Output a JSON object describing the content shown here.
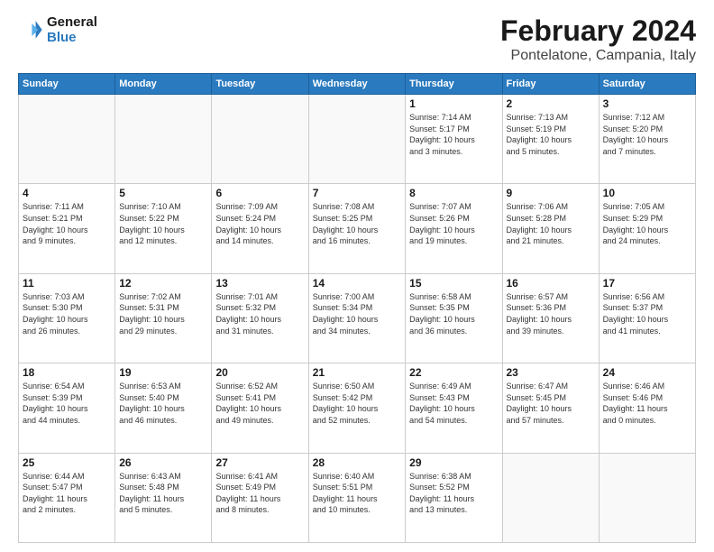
{
  "header": {
    "logo_line1": "General",
    "logo_line2": "Blue",
    "title": "February 2024",
    "subtitle": "Pontelatone, Campania, Italy"
  },
  "weekdays": [
    "Sunday",
    "Monday",
    "Tuesday",
    "Wednesday",
    "Thursday",
    "Friday",
    "Saturday"
  ],
  "weeks": [
    [
      {
        "day": "",
        "info": ""
      },
      {
        "day": "",
        "info": ""
      },
      {
        "day": "",
        "info": ""
      },
      {
        "day": "",
        "info": ""
      },
      {
        "day": "1",
        "info": "Sunrise: 7:14 AM\nSunset: 5:17 PM\nDaylight: 10 hours\nand 3 minutes."
      },
      {
        "day": "2",
        "info": "Sunrise: 7:13 AM\nSunset: 5:19 PM\nDaylight: 10 hours\nand 5 minutes."
      },
      {
        "day": "3",
        "info": "Sunrise: 7:12 AM\nSunset: 5:20 PM\nDaylight: 10 hours\nand 7 minutes."
      }
    ],
    [
      {
        "day": "4",
        "info": "Sunrise: 7:11 AM\nSunset: 5:21 PM\nDaylight: 10 hours\nand 9 minutes."
      },
      {
        "day": "5",
        "info": "Sunrise: 7:10 AM\nSunset: 5:22 PM\nDaylight: 10 hours\nand 12 minutes."
      },
      {
        "day": "6",
        "info": "Sunrise: 7:09 AM\nSunset: 5:24 PM\nDaylight: 10 hours\nand 14 minutes."
      },
      {
        "day": "7",
        "info": "Sunrise: 7:08 AM\nSunset: 5:25 PM\nDaylight: 10 hours\nand 16 minutes."
      },
      {
        "day": "8",
        "info": "Sunrise: 7:07 AM\nSunset: 5:26 PM\nDaylight: 10 hours\nand 19 minutes."
      },
      {
        "day": "9",
        "info": "Sunrise: 7:06 AM\nSunset: 5:28 PM\nDaylight: 10 hours\nand 21 minutes."
      },
      {
        "day": "10",
        "info": "Sunrise: 7:05 AM\nSunset: 5:29 PM\nDaylight: 10 hours\nand 24 minutes."
      }
    ],
    [
      {
        "day": "11",
        "info": "Sunrise: 7:03 AM\nSunset: 5:30 PM\nDaylight: 10 hours\nand 26 minutes."
      },
      {
        "day": "12",
        "info": "Sunrise: 7:02 AM\nSunset: 5:31 PM\nDaylight: 10 hours\nand 29 minutes."
      },
      {
        "day": "13",
        "info": "Sunrise: 7:01 AM\nSunset: 5:32 PM\nDaylight: 10 hours\nand 31 minutes."
      },
      {
        "day": "14",
        "info": "Sunrise: 7:00 AM\nSunset: 5:34 PM\nDaylight: 10 hours\nand 34 minutes."
      },
      {
        "day": "15",
        "info": "Sunrise: 6:58 AM\nSunset: 5:35 PM\nDaylight: 10 hours\nand 36 minutes."
      },
      {
        "day": "16",
        "info": "Sunrise: 6:57 AM\nSunset: 5:36 PM\nDaylight: 10 hours\nand 39 minutes."
      },
      {
        "day": "17",
        "info": "Sunrise: 6:56 AM\nSunset: 5:37 PM\nDaylight: 10 hours\nand 41 minutes."
      }
    ],
    [
      {
        "day": "18",
        "info": "Sunrise: 6:54 AM\nSunset: 5:39 PM\nDaylight: 10 hours\nand 44 minutes."
      },
      {
        "day": "19",
        "info": "Sunrise: 6:53 AM\nSunset: 5:40 PM\nDaylight: 10 hours\nand 46 minutes."
      },
      {
        "day": "20",
        "info": "Sunrise: 6:52 AM\nSunset: 5:41 PM\nDaylight: 10 hours\nand 49 minutes."
      },
      {
        "day": "21",
        "info": "Sunrise: 6:50 AM\nSunset: 5:42 PM\nDaylight: 10 hours\nand 52 minutes."
      },
      {
        "day": "22",
        "info": "Sunrise: 6:49 AM\nSunset: 5:43 PM\nDaylight: 10 hours\nand 54 minutes."
      },
      {
        "day": "23",
        "info": "Sunrise: 6:47 AM\nSunset: 5:45 PM\nDaylight: 10 hours\nand 57 minutes."
      },
      {
        "day": "24",
        "info": "Sunrise: 6:46 AM\nSunset: 5:46 PM\nDaylight: 11 hours\nand 0 minutes."
      }
    ],
    [
      {
        "day": "25",
        "info": "Sunrise: 6:44 AM\nSunset: 5:47 PM\nDaylight: 11 hours\nand 2 minutes."
      },
      {
        "day": "26",
        "info": "Sunrise: 6:43 AM\nSunset: 5:48 PM\nDaylight: 11 hours\nand 5 minutes."
      },
      {
        "day": "27",
        "info": "Sunrise: 6:41 AM\nSunset: 5:49 PM\nDaylight: 11 hours\nand 8 minutes."
      },
      {
        "day": "28",
        "info": "Sunrise: 6:40 AM\nSunset: 5:51 PM\nDaylight: 11 hours\nand 10 minutes."
      },
      {
        "day": "29",
        "info": "Sunrise: 6:38 AM\nSunset: 5:52 PM\nDaylight: 11 hours\nand 13 minutes."
      },
      {
        "day": "",
        "info": ""
      },
      {
        "day": "",
        "info": ""
      }
    ]
  ]
}
